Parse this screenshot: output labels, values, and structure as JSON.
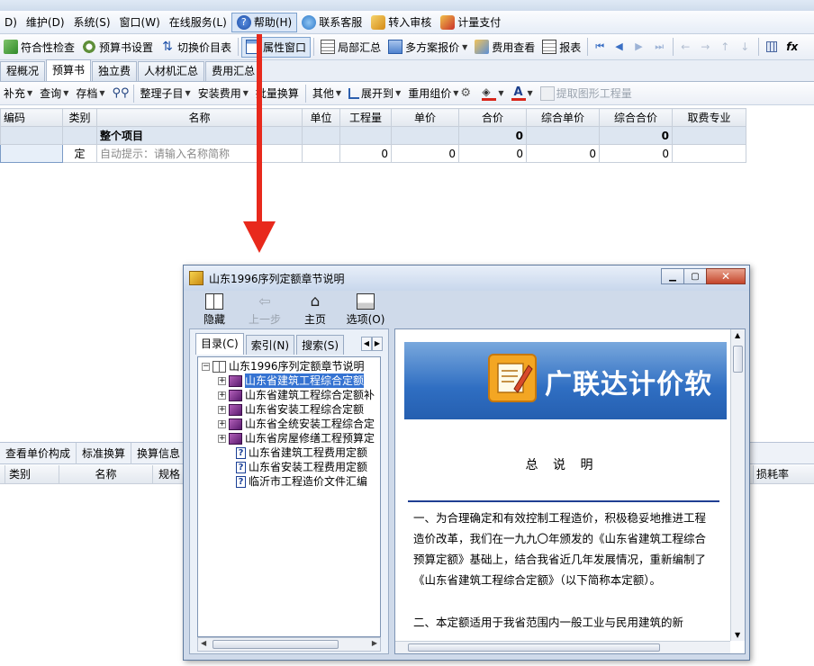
{
  "menu": {
    "items": [
      "D)",
      "维护(D)",
      "系统(S)",
      "窗口(W)",
      "在线服务(L)",
      "帮助(H)",
      "联系客服",
      "转入审核",
      "计量支付"
    ]
  },
  "toolbar1": {
    "items": [
      "符合性检查",
      "预算书设置",
      "切换价目表",
      "属性窗口",
      "局部汇总",
      "多方案报价",
      "费用查看",
      "报表"
    ]
  },
  "tabs": [
    "程概况",
    "预算书",
    "独立费",
    "人材机汇总",
    "费用汇总"
  ],
  "toolbar2": {
    "items": [
      "补充",
      "查询",
      "存档",
      "整理子目",
      "安装费用",
      "批量换算",
      "其他",
      "展开到",
      "重用组价",
      "提取图形工程量"
    ]
  },
  "grid": {
    "headers": [
      "编码",
      "类别",
      "名称",
      "单位",
      "工程量",
      "单价",
      "合价",
      "综合单价",
      "综合合价",
      "取费专业"
    ],
    "total_row": {
      "name": "整个项目",
      "total": "0",
      "comp_total": "0"
    },
    "entry_row": {
      "type": "定",
      "hint": "自动提示：请输入名称简称",
      "qty": "0",
      "price": "0",
      "total": "0",
      "comp_price": "0",
      "comp_total": "0"
    }
  },
  "lower": {
    "tabs": [
      "查看单价构成",
      "标准换算",
      "换算信息"
    ],
    "headers": [
      "类别",
      "名称",
      "规格",
      "损耗率"
    ]
  },
  "help_window": {
    "title": "山东1996序列定额章节说明",
    "toolbar": [
      "隐藏",
      "上一步",
      "主页",
      "选项(O)"
    ],
    "nav_tabs": [
      "目录(C)",
      "索引(N)",
      "搜索(S)"
    ],
    "tree": {
      "root": "山东1996序列定额章节说明",
      "books": [
        "山东省建筑工程综合定额",
        "山东省建筑工程综合定额补",
        "山东省安装工程综合定额",
        "山东省全统安装工程综合定",
        "山东省房屋修缮工程预算定"
      ],
      "pages": [
        "山东省建筑工程费用定额",
        "山东省安装工程费用定额",
        "临沂市工程造价文件汇编"
      ]
    },
    "content": {
      "brand": "广联达计价软",
      "heading": "总 说 明",
      "paragraphs": [
        "一、为合理确定和有效控制工程造价，积极稳妥地推进工程造价改革，我们在一九九〇年颁发的《山东省建筑工程综合预算定额》基础上，结合我省近几年发展情况，重新编制了《山东省建筑工程综合定额》（以下简称本定额）。",
        "二、本定额适用于我省范围内一般工业与民用建筑的新"
      ]
    }
  },
  "colors": {
    "accent": "#3573d2",
    "arrow": "#e8291c",
    "banner": "#2f6ec2"
  }
}
